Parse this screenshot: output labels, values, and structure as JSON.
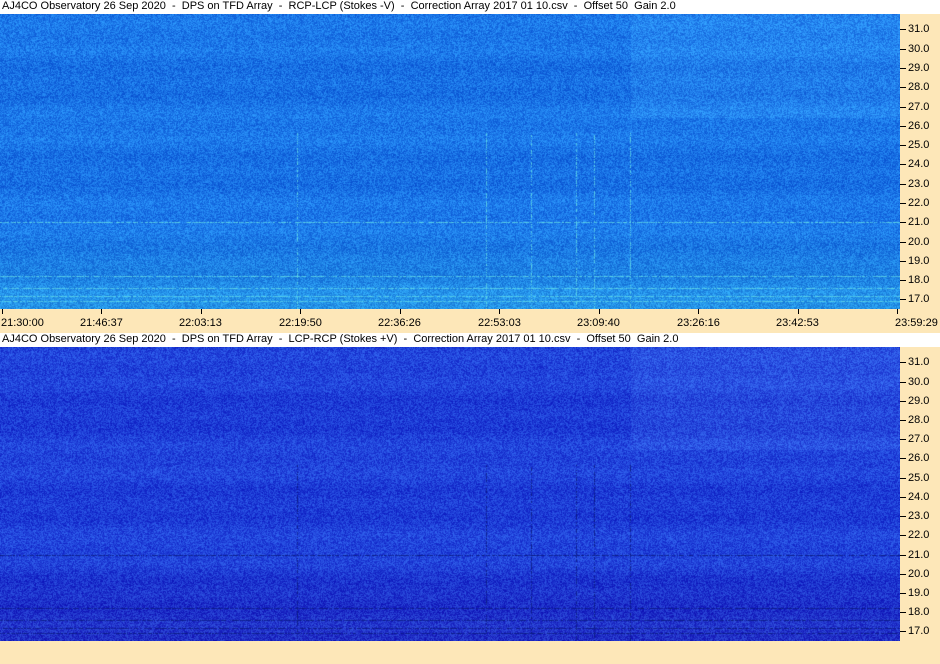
{
  "chart_data": [
    {
      "type": "heatmap",
      "title": "AJ4CO Observatory 26 Sep 2020  -  DPS on TFD Array  -  RCP-LCP (Stokes -V)  -  Correction Array 2017 01 10.csv  -  Offset 50  Gain 2.0",
      "x_ticks": [
        "21:30:00",
        "21:46:37",
        "22:03:13",
        "22:19:50",
        "22:36:26",
        "22:53:03",
        "23:09:40",
        "23:26:16",
        "23:42:53",
        "23:59:29"
      ],
      "y_ticks": [
        "31.0",
        "30.0",
        "29.0",
        "28.0",
        "27.0",
        "26.0",
        "25.0",
        "24.0",
        "23.0",
        "22.0",
        "21.0",
        "20.0",
        "19.0",
        "18.0",
        "17.0"
      ],
      "ylim": [
        16.5,
        31.8
      ],
      "colormap": "blue",
      "base_color": "#1a74e6",
      "highlight_color": "#5fd8e6"
    },
    {
      "type": "heatmap",
      "title": "AJ4CO Observatory 26 Sep 2020  -  DPS on TFD Array  -  LCP-RCP (Stokes +V)  -  Correction Array 2017 01 10.csv  -  Offset 50  Gain 2.0",
      "x_ticks": [],
      "y_ticks": [
        "31.0",
        "30.0",
        "29.0",
        "28.0",
        "27.0",
        "26.0",
        "25.0",
        "24.0",
        "23.0",
        "22.0",
        "21.0",
        "20.0",
        "19.0",
        "18.0",
        "17.0"
      ],
      "ylim": [
        16.5,
        31.8
      ],
      "colormap": "blue",
      "base_color": "#1f40d8",
      "highlight_color": "#0a1a80"
    }
  ],
  "colors": {
    "axis_background": "#fde7b8"
  }
}
